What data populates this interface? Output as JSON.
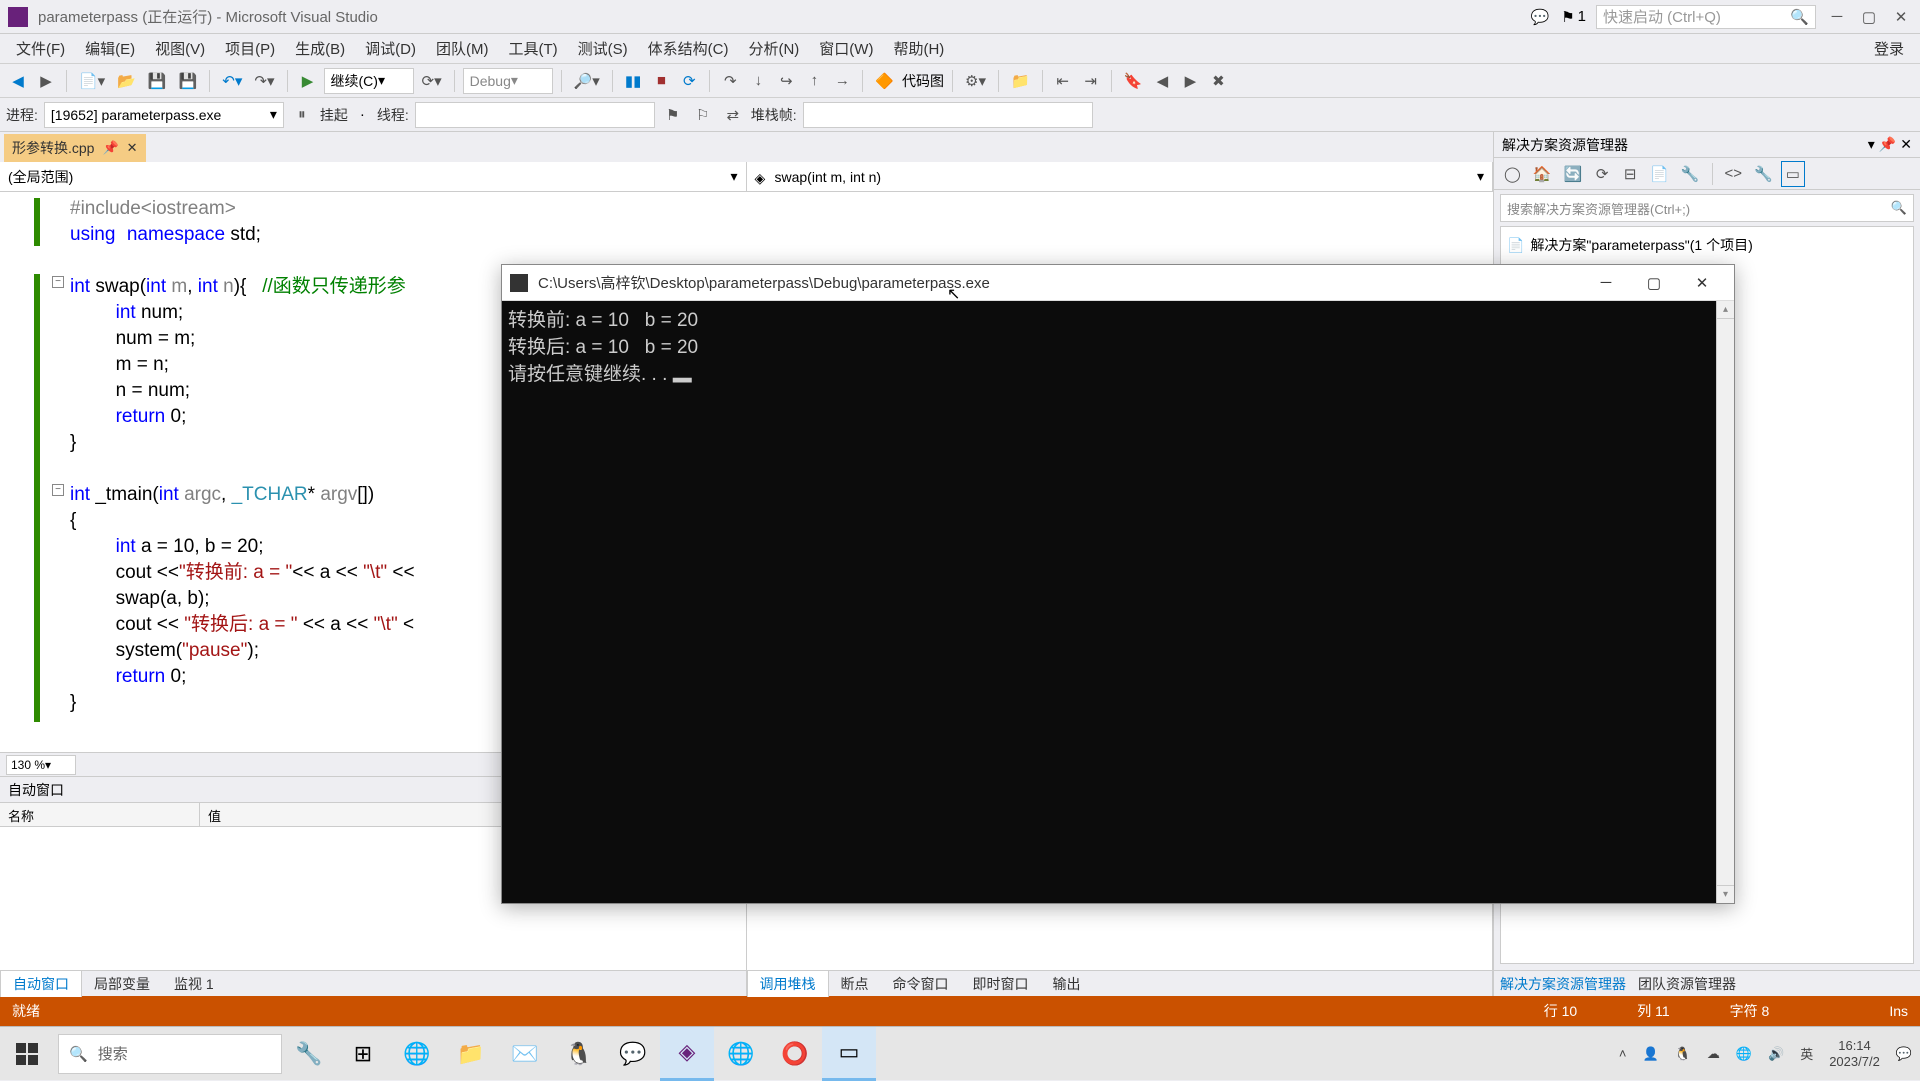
{
  "titlebar": {
    "title": "parameterpass (正在运行) - Microsoft Visual Studio",
    "notifications": "1",
    "quick_launch_placeholder": "快速启动 (Ctrl+Q)"
  },
  "menu": {
    "file": "文件(F)",
    "edit": "编辑(E)",
    "view": "视图(V)",
    "project": "项目(P)",
    "build": "生成(B)",
    "debug": "调试(D)",
    "team": "团队(M)",
    "tools": "工具(T)",
    "test": "测试(S)",
    "arch": "体系结构(C)",
    "analyze": "分析(N)",
    "window": "窗口(W)",
    "help": "帮助(H)",
    "login": "登录"
  },
  "toolbar": {
    "continue": "继续(C)",
    "config": "Debug",
    "codemap": "代码图"
  },
  "toolbar2": {
    "process_label": "进程:",
    "process_value": "[19652] parameterpass.exe",
    "suspend": "挂起",
    "thread_label": "线程:",
    "stackframe_label": "堆栈帧:"
  },
  "tabs": {
    "file_tab": "形参转换.cpp"
  },
  "scopes": {
    "global": "(全局范围)",
    "function": "swap(int m, int n)"
  },
  "code": {
    "l1a": "#include",
    "l1b": "<iostream>",
    "l2a": "using",
    "l2b": "namespace",
    "l2c": " std;",
    "l3a": "int",
    "l3b": " swap(",
    "l3c": "int",
    "l3d": " m",
    "l3e": ", ",
    "l3f": "int",
    "l3g": " n",
    "l3h": "){   ",
    "l3cmt": "//函数只传递形参",
    "l4a": "int",
    "l4b": " num;",
    "l5": "num = m;",
    "l6": "m = n;",
    "l7": "n = num;",
    "l8a": "return",
    "l8b": " 0;",
    "l9": "}",
    "l11a": "int",
    "l11b": " _tmain(",
    "l11c": "int",
    "l11d": " argc",
    "l11e": ", ",
    "l11f": "_TCHAR",
    "l11g": "* ",
    "l11h": "argv",
    "l11i": "[])",
    "l12": "{",
    "l13a": "int",
    "l13b": " a = 10, b = 20;",
    "l14a": "cout <<",
    "l14b": "\"转换前: a = \"",
    "l14c": "<< a << ",
    "l14d": "\"\\t\"",
    "l14e": " <<",
    "l15": "swap(a, b);",
    "l16a": "cout << ",
    "l16b": "\"转换后: a = \"",
    "l16c": " << a << ",
    "l16d": "\"\\t\"",
    "l16e": " <",
    "l17a": "system(",
    "l17b": "\"pause\"",
    "l17c": ");",
    "l18a": "return",
    "l18b": " 0;",
    "l19": "}"
  },
  "zoom": "130 %",
  "auto_panel": {
    "title": "自动窗口",
    "col_name": "名称",
    "col_value": "值"
  },
  "bottom_tabs": {
    "auto": "自动窗口",
    "locals": "局部变量",
    "watch": "监视 1"
  },
  "right_tabs": {
    "callstack": "调用堆栈",
    "breakpoints": "断点",
    "command": "命令窗口",
    "immediate": "即时窗口",
    "output": "输出"
  },
  "solution": {
    "title": "解决方案资源管理器",
    "search_placeholder": "搜索解决方案资源管理器(Ctrl+;)",
    "root": "解决方案\"parameterpass\"(1 个项目)"
  },
  "solution_tabs": {
    "solution_explorer": "解决方案资源管理器",
    "team_explorer": "团队资源管理器"
  },
  "statusbar": {
    "ready": "就绪",
    "line": "行 10",
    "col": "列 11",
    "char": "字符 8",
    "ins": "Ins"
  },
  "console": {
    "title": "C:\\Users\\高梓钦\\Desktop\\parameterpass\\Debug\\parameterpass.exe",
    "line1": "转换前: a = 10   b = 20",
    "line2": "转换后: a = 10   b = 20",
    "line3": "请按任意键继续. . . ",
    "cursor": "▂"
  },
  "taskbar": {
    "search": "搜索",
    "ime": "英",
    "time": "16:14",
    "date": "2023/7/2"
  }
}
